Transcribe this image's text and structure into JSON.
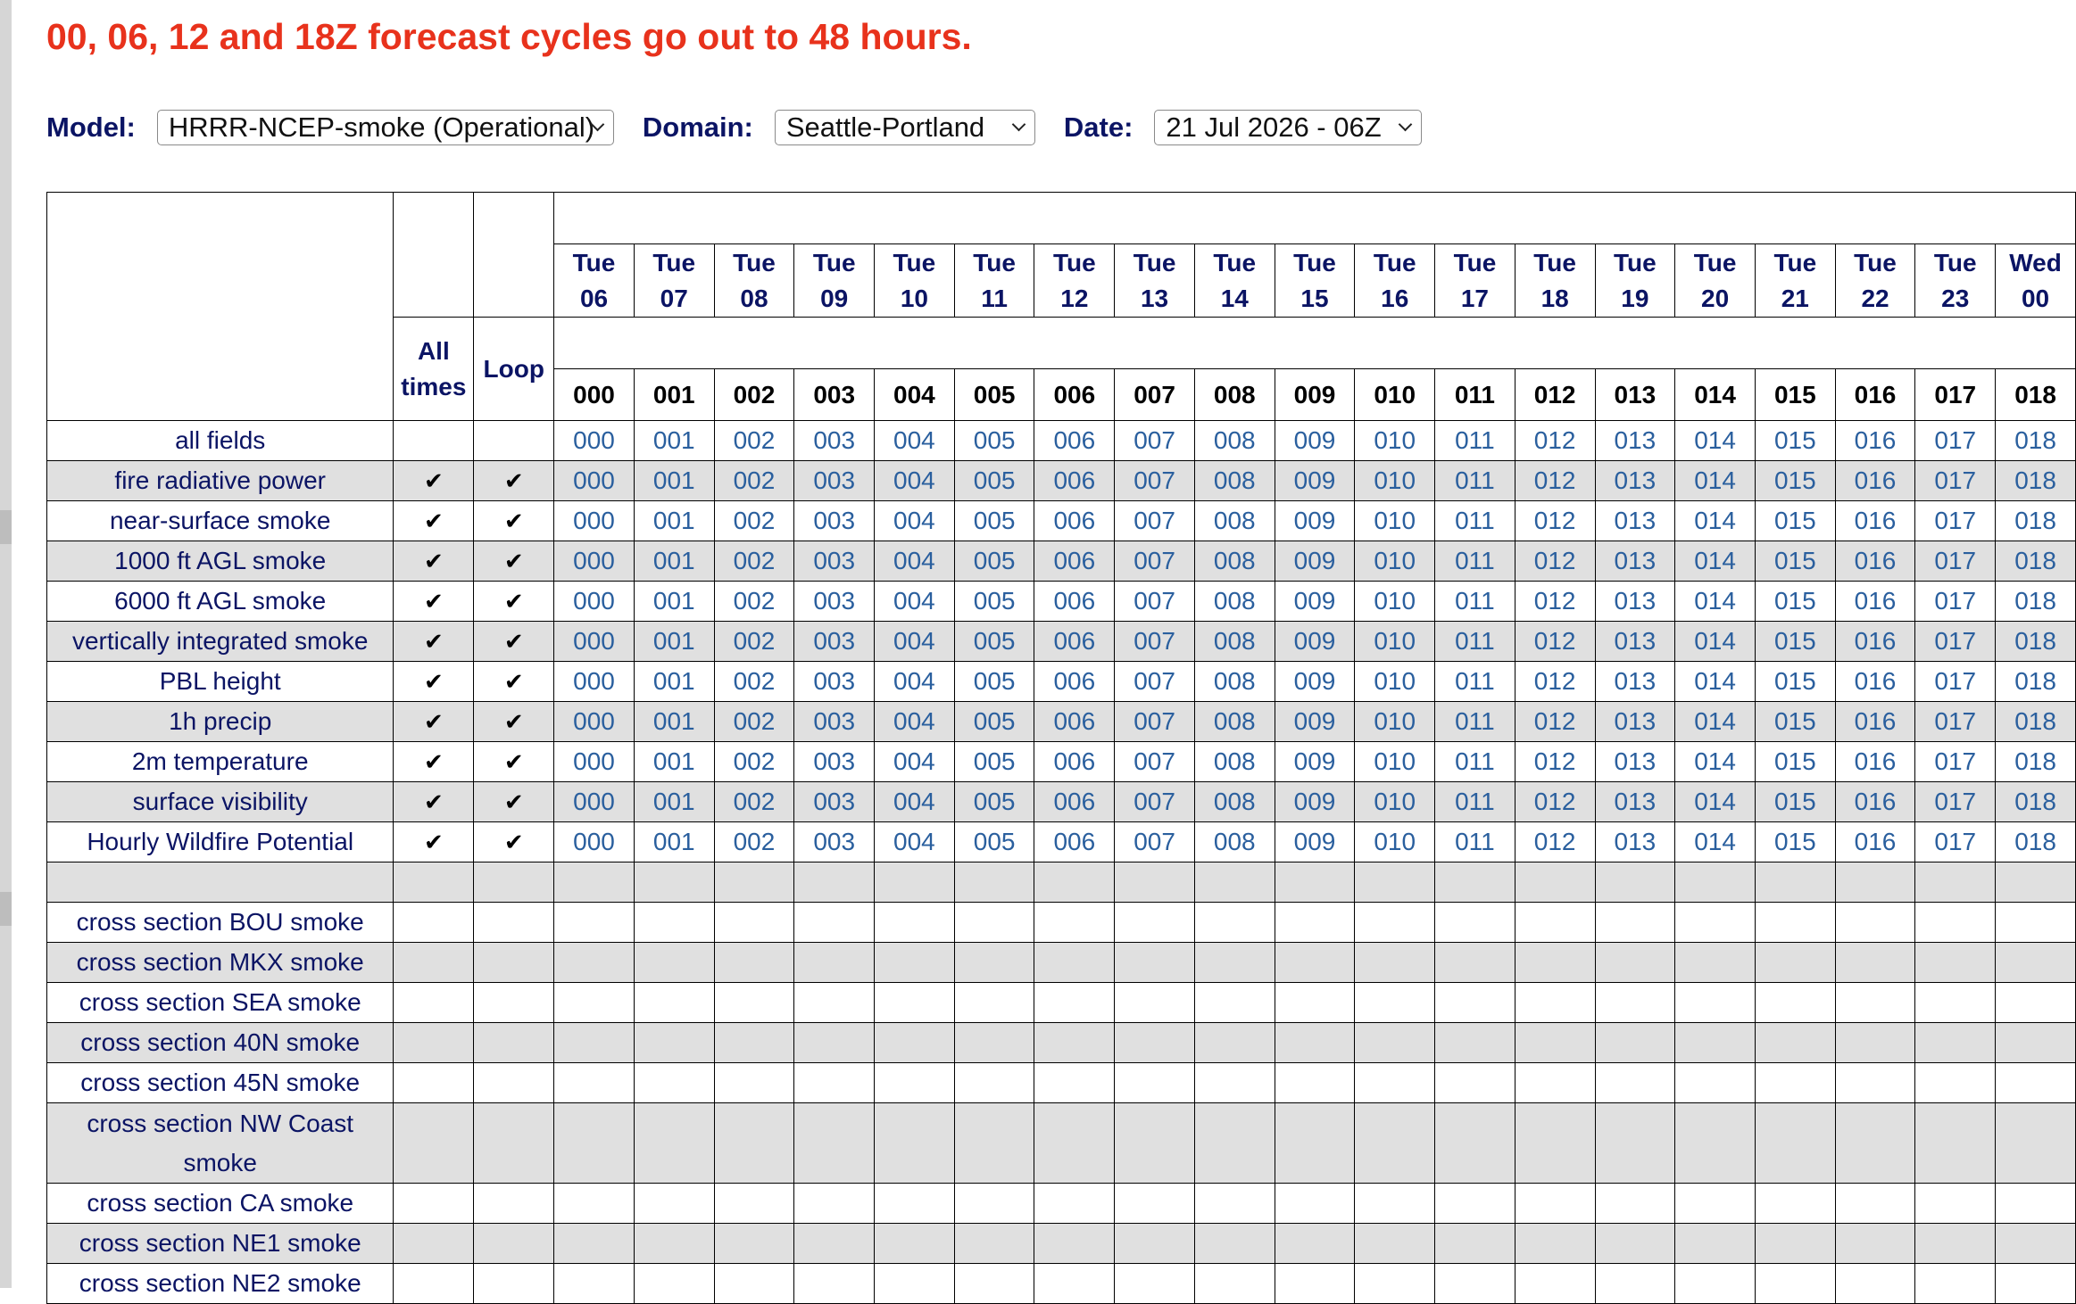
{
  "notice": "00, 06, 12 and 18Z forecast cycles go out to 48 hours.",
  "controls": {
    "model_label": "Model:",
    "model_value": "HRRR-NCEP-smoke (Operational)",
    "domain_label": "Domain:",
    "domain_value": "Seattle-Portland",
    "date_label": "Date:",
    "date_value": "21 Jul 2026 - 06Z"
  },
  "headers": {
    "all_times": "All times",
    "loop": "Loop",
    "valid_days": [
      "Tue",
      "Tue",
      "Tue",
      "Tue",
      "Tue",
      "Tue",
      "Tue",
      "Tue",
      "Tue",
      "Tue",
      "Tue",
      "Tue",
      "Tue",
      "Tue",
      "Tue",
      "Tue",
      "Tue",
      "Tue",
      "Wed"
    ],
    "valid_hours": [
      "06",
      "07",
      "08",
      "09",
      "10",
      "11",
      "12",
      "13",
      "14",
      "15",
      "16",
      "17",
      "18",
      "19",
      "20",
      "21",
      "22",
      "23",
      "00"
    ],
    "forecast_hours": [
      "000",
      "001",
      "002",
      "003",
      "004",
      "005",
      "006",
      "007",
      "008",
      "009",
      "010",
      "011",
      "012",
      "013",
      "014",
      "015",
      "016",
      "017",
      "018"
    ]
  },
  "check_glyph": "✔",
  "field_rows": [
    {
      "name": "all fields",
      "checks": false
    },
    {
      "name": "fire radiative power",
      "checks": true
    },
    {
      "name": "near-surface smoke",
      "checks": true
    },
    {
      "name": "1000 ft AGL smoke",
      "checks": true
    },
    {
      "name": "6000 ft AGL smoke",
      "checks": true
    },
    {
      "name": "vertically integrated smoke",
      "checks": true
    },
    {
      "name": "PBL height",
      "checks": true
    },
    {
      "name": "1h precip",
      "checks": true
    },
    {
      "name": "2m temperature",
      "checks": true
    },
    {
      "name": "surface visibility",
      "checks": true
    },
    {
      "name": "Hourly Wildfire Potential",
      "checks": true
    }
  ],
  "cross_section_rows": [
    "cross section BOU smoke",
    "cross section MKX smoke",
    "cross section SEA smoke",
    "cross section 40N smoke",
    "cross section 45N smoke",
    "cross section NW Coast smoke",
    "cross section CA smoke",
    "cross section NE1 smoke",
    "cross section NE2 smoke"
  ],
  "colors": {
    "notice": "#e8321c",
    "label_navy": "#0b1464",
    "link_blue": "#2a5f9e",
    "row_alt": "#e0e0e0"
  }
}
